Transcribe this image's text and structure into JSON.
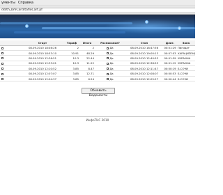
{
  "menu": [
    {
      "label": "ументы",
      "underline": ""
    },
    {
      "label": "Справка",
      "underline": "С"
    }
  ],
  "address": {
    "value": "dd/th_bmCard/tafloCart.pf"
  },
  "table": {
    "headers": [
      "",
      "",
      "Старт",
      "Тариф",
      "Итого",
      "Расписание?",
      "Стоп",
      "Длит.",
      "Зона"
    ],
    "rows": [
      [
        "",
        "",
        "08.09.2010 18:46:26",
        "2",
        "2",
        "Да",
        "08.09.2010 18:47:56",
        "00:01:29",
        "Пигидат"
      ],
      [
        "",
        "",
        "08.09.2010 18:53:10",
        "10.91",
        "48.29",
        "Да",
        "08.09.2010 19:00:13",
        "00:07:03",
        "ХАРАЦИЗЕНДАН"
      ],
      [
        "",
        "",
        "08.09.2010 12:36:51",
        "10.3",
        "22.44",
        "Да",
        "08.09.2010 12:40:53",
        "00:01:59",
        "УКРАИНА"
      ],
      [
        "",
        "",
        "08.09.2010 12:33:01",
        "10.3",
        "11.22",
        "Да",
        "08.09.2010 12:38:53",
        "00:01:12",
        "УКРАИНА"
      ],
      [
        "",
        "",
        "08.09.2010 12:10:52",
        "3.85",
        "8.47",
        "Да",
        "08.09.2010 12:11:47",
        "00:00:19",
        "Б.СОЧИ"
      ],
      [
        "",
        "",
        "08.09.2010 12:07:07",
        "3.85",
        "12.71",
        "Да",
        "08.09.2010 12:08:07",
        "00:00:53",
        "Б.СОЧИ"
      ],
      [
        "",
        "",
        "08.09.2010 12:04:37",
        "3.85",
        "6.24",
        "Да",
        "08.09.2010 12:05:27",
        "00:00:44",
        "Б.СОЧИ"
      ]
    ]
  },
  "refresh_button": "Обновить Ведомости",
  "footer": "ИнфоТНС 2010"
}
